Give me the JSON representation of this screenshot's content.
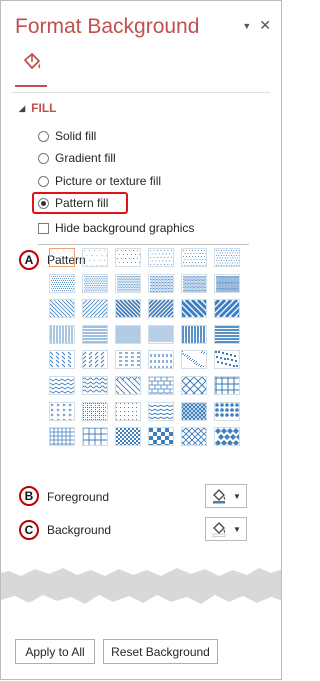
{
  "pane": {
    "title": "Format Background",
    "menu_glyph": "▼",
    "close_glyph": "✕",
    "tab_icon": "paint-bucket-icon"
  },
  "fill": {
    "section_label": "FILL",
    "options": [
      {
        "label": "Solid fill",
        "selected": false
      },
      {
        "label": "Gradient fill",
        "selected": false
      },
      {
        "label": "Picture or texture fill",
        "selected": false
      },
      {
        "label": "Pattern fill",
        "selected": true
      }
    ],
    "hide_graphics": {
      "label": "Hide background graphics",
      "checked": false
    }
  },
  "pattern": {
    "badge": "A",
    "label": "Pattern",
    "color": "#3f7fbf",
    "selected_index": 0,
    "swatches": [
      "dots05",
      "dots10",
      "dots20",
      "dots25",
      "dots30",
      "dots40",
      "dots50",
      "dots60",
      "dots70",
      "dots75",
      "dots80",
      "dots90",
      "ltdiag-dn",
      "ltdiag-up",
      "dkdiag-dn",
      "dkdiag-up",
      "wddiag-dn",
      "wddiag-up",
      "ltvert",
      "lthorz",
      "nrvert",
      "nrhorz",
      "dkvert",
      "dkhorz",
      "dsh-dn",
      "dsh-up",
      "dsh-horz",
      "dsh-vert",
      "sm-confetti",
      "lg-confetti",
      "zigzag",
      "wave",
      "diag-brick",
      "horz-brick",
      "weave",
      "plaid",
      "divot",
      "dot-grid",
      "dot-diamond",
      "shingle",
      "trellis",
      "sphere",
      "sm-grid",
      "lg-grid",
      "sm-checker",
      "lg-checker",
      "outl-diamond",
      "solid-diamond"
    ]
  },
  "foreground": {
    "badge": "B",
    "label": "Foreground",
    "icon": "paint-bucket-icon"
  },
  "background": {
    "badge": "C",
    "label": "Background",
    "icon": "paint-bucket-icon"
  },
  "buttons": {
    "apply_all": "Apply to All",
    "reset": "Reset Background"
  }
}
